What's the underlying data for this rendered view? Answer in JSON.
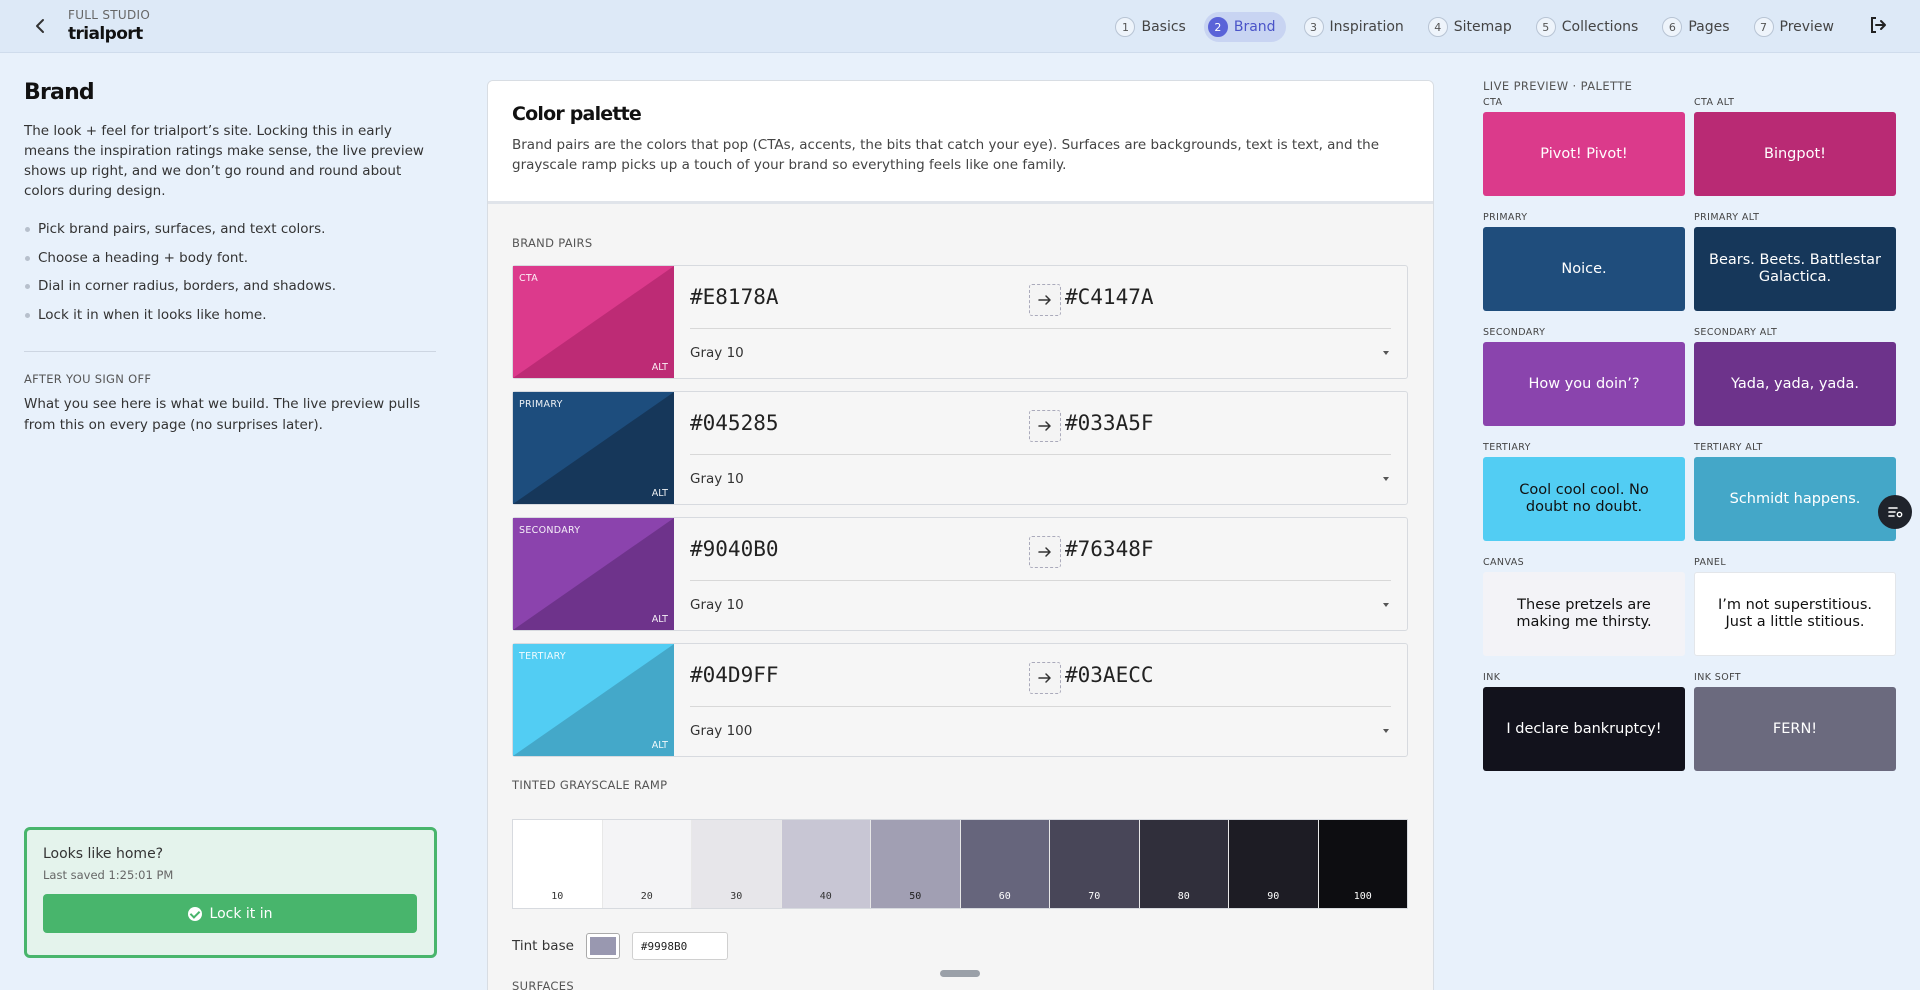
{
  "header": {
    "studio_label": "FULL STUDIO",
    "project_name": "trialport",
    "steps": [
      {
        "num": "1",
        "label": "Basics"
      },
      {
        "num": "2",
        "label": "Brand"
      },
      {
        "num": "3",
        "label": "Inspiration"
      },
      {
        "num": "4",
        "label": "Sitemap"
      },
      {
        "num": "5",
        "label": "Collections"
      },
      {
        "num": "6",
        "label": "Pages"
      },
      {
        "num": "7",
        "label": "Preview"
      }
    ],
    "active_step": "Brand",
    "back_icon": "chevron-left-icon",
    "exit_icon": "sign-out-icon"
  },
  "left": {
    "title": "Brand",
    "intro": "The look + feel for trialport’s site. Locking this in early means the inspiration ratings make sense, the live preview shows up right, and we don’t go round and round about colors during design.",
    "bullets": [
      "Pick brand pairs, surfaces, and text colors.",
      "Choose a heading + body font.",
      "Dial in corner radius, borders, and shadows.",
      "Lock it in when it looks like home."
    ],
    "after_heading": "AFTER YOU SIGN OFF",
    "after_body": "What you see here is what we build. The live preview pulls from this on every page (no surprises later).",
    "lock_question": "Looks like home?",
    "last_saved": "Last saved 1:25:01 PM",
    "lock_button": "Lock it in"
  },
  "palette": {
    "title": "Color palette",
    "description": "Brand pairs are the colors that pop (CTAs, accents, the bits that catch your eye). Surfaces are backgrounds, text is text, and the grayscale ramp picks up a touch of your brand so everything feels like one family.",
    "brand_pairs_label": "BRAND PAIRS",
    "alt_tag": "ALT",
    "pairs": [
      {
        "name": "CTA",
        "base": "#E8178A",
        "alt": "#C4147A",
        "base_color": "#dc3a8c",
        "alt_color": "#bd2b75",
        "text_color": "Gray 10"
      },
      {
        "name": "PRIMARY",
        "base": "#045285",
        "alt": "#033A5F",
        "base_color": "#1d4d7d",
        "alt_color": "#16375a",
        "text_color": "Gray 10"
      },
      {
        "name": "SECONDARY",
        "base": "#9040B0",
        "alt": "#76348F",
        "base_color": "#8b43ad",
        "alt_color": "#6e338b",
        "text_color": "Gray 10"
      },
      {
        "name": "TERTIARY",
        "base": "#04D9FF",
        "alt": "#03AECC",
        "base_color": "#52cdf3",
        "alt_color": "#44a8c9",
        "text_color": "Gray 100"
      }
    ],
    "ramp_label": "TINTED GRAYSCALE RAMP",
    "ramp": [
      {
        "label": "10",
        "color": "#ffffff",
        "text": "#333333"
      },
      {
        "label": "20",
        "color": "#f4f4f6",
        "text": "#333333"
      },
      {
        "label": "30",
        "color": "#e7e6ea",
        "text": "#333333"
      },
      {
        "label": "40",
        "color": "#c8c6d4",
        "text": "#333333"
      },
      {
        "label": "50",
        "color": "#a19fb3",
        "text": "#222222"
      },
      {
        "label": "60",
        "color": "#66657c",
        "text": "#ffffff"
      },
      {
        "label": "70",
        "color": "#484658",
        "text": "#ffffff"
      },
      {
        "label": "80",
        "color": "#302f3b",
        "text": "#ffffff"
      },
      {
        "label": "90",
        "color": "#1d1c24",
        "text": "#ffffff"
      },
      {
        "label": "100",
        "color": "#0d0d11",
        "text": "#ffffff"
      }
    ],
    "tint_label": "Tint base",
    "tint_value": "#9998B0",
    "tint_color": "#9998b0",
    "surfaces_label": "SURFACES"
  },
  "preview": {
    "title": "LIVE PREVIEW · PALETTE",
    "tiles": [
      {
        "label": "CTA",
        "text": "Pivot! Pivot!",
        "bg": "#db3a8b",
        "fg": "#ffffff"
      },
      {
        "label": "CTA ALT",
        "text": "Bingpot!",
        "bg": "#b92a74",
        "fg": "#ffffff"
      },
      {
        "label": "PRIMARY",
        "text": "Noice.",
        "bg": "#1f4d7c",
        "fg": "#ffffff"
      },
      {
        "label": "PRIMARY ALT",
        "text": "Bears. Beets. Battlestar Galactica.",
        "bg": "#16375a",
        "fg": "#ffffff"
      },
      {
        "label": "SECONDARY",
        "text": "How you doin’?",
        "bg": "#8a44ad",
        "fg": "#ffffff"
      },
      {
        "label": "SECONDARY ALT",
        "text": "Yada, yada, yada.",
        "bg": "#6d338b",
        "fg": "#ffffff"
      },
      {
        "label": "TERTIARY",
        "text": "Cool cool cool. No doubt no doubt.",
        "bg": "#52cdf3",
        "fg": "#111111"
      },
      {
        "label": "TERTIARY ALT",
        "text": "Schmidt happens.",
        "bg": "#44a7c8",
        "fg": "#ffffff"
      },
      {
        "label": "CANVAS",
        "text": "These pretzels are making me thirsty.",
        "bg": "#f3f3f7",
        "fg": "#111111"
      },
      {
        "label": "PANEL",
        "text": "I’m not superstitious. Just a little stitious.",
        "bg": "#ffffff",
        "fg": "#111111"
      },
      {
        "label": "INK",
        "text": "I declare bankruptcy!",
        "bg": "#12121c",
        "fg": "#ffffff"
      },
      {
        "label": "INK SOFT",
        "text": "FERN!",
        "bg": "#6b6a7e",
        "fg": "#ffffff"
      }
    ]
  }
}
